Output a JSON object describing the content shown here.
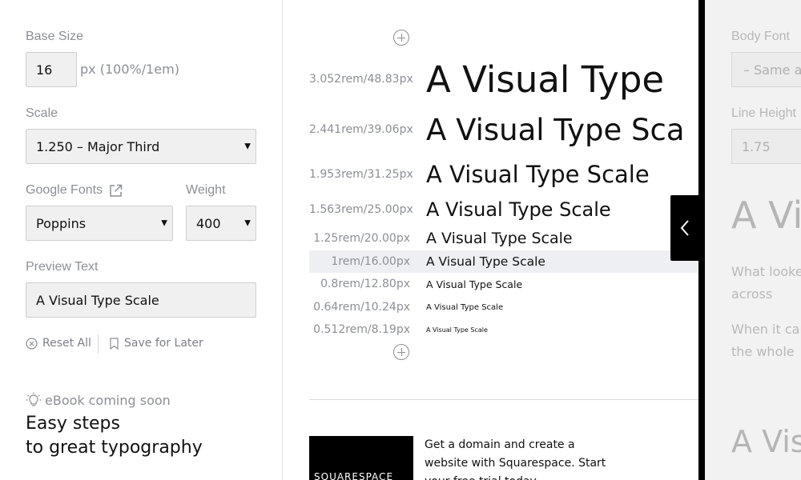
{
  "sidebar": {
    "base_size_label": "Base Size",
    "base_size_value": "16",
    "base_size_hint": "px (100%/1em)",
    "scale_label": "Scale",
    "scale_value": "1.250 – Major Third",
    "google_fonts_label": "Google Fonts",
    "font_value": "Poppins",
    "weight_label": "Weight",
    "weight_value": "400",
    "preview_text_label": "Preview Text",
    "preview_text_value": "A Visual Type Scale",
    "reset_label": "Reset All",
    "save_label": "Save for Later",
    "ebook_label": "eBook coming soon",
    "ebook_title_line1": "Easy steps",
    "ebook_title_line2": "to great typography"
  },
  "scale": {
    "preview_text": "A Visual Type Scale",
    "rows": [
      {
        "size": "3.052rem/48.83px",
        "text": "A Visual Type"
      },
      {
        "size": "2.441rem/39.06px",
        "text": "A Visual Type Sca"
      },
      {
        "size": "1.953rem/31.25px",
        "text": "A Visual Type Scale"
      },
      {
        "size": "1.563rem/25.00px",
        "text": "A Visual Type Scale"
      },
      {
        "size": "1.25rem/20.00px",
        "text": "A Visual Type Scale"
      },
      {
        "size": "1rem/16.00px",
        "text": "A Visual Type Scale"
      },
      {
        "size": "0.8rem/12.80px",
        "text": "A Visual Type Scale"
      },
      {
        "size": "0.64rem/10.24px",
        "text": "A Visual Type Scale"
      },
      {
        "size": "0.512rem/8.19px",
        "text": "A Visual Type Scale"
      }
    ]
  },
  "ad": {
    "logo_text": "SQUARESPACE",
    "text": "Get a domain and create a website with Squarespace. Start your free trial today."
  },
  "drawer": {
    "body_font_label": "Body Font",
    "body_font_value": "– Same as",
    "line_height_label": "Line Height",
    "line_height_value": "1.75",
    "preview_heading": "A Vi",
    "para1": "What looked like a tiny speck moving across",
    "para2": "When it came close, blades, but in the whole",
    "preview_heading2": "A Vis"
  },
  "icons": {
    "toggle": "chevron-left-icon",
    "external": "external-link-icon",
    "reset": "close-circle-icon",
    "save": "bookmark-icon",
    "ebook": "lightbulb-icon",
    "add": "plus-circle-icon"
  }
}
